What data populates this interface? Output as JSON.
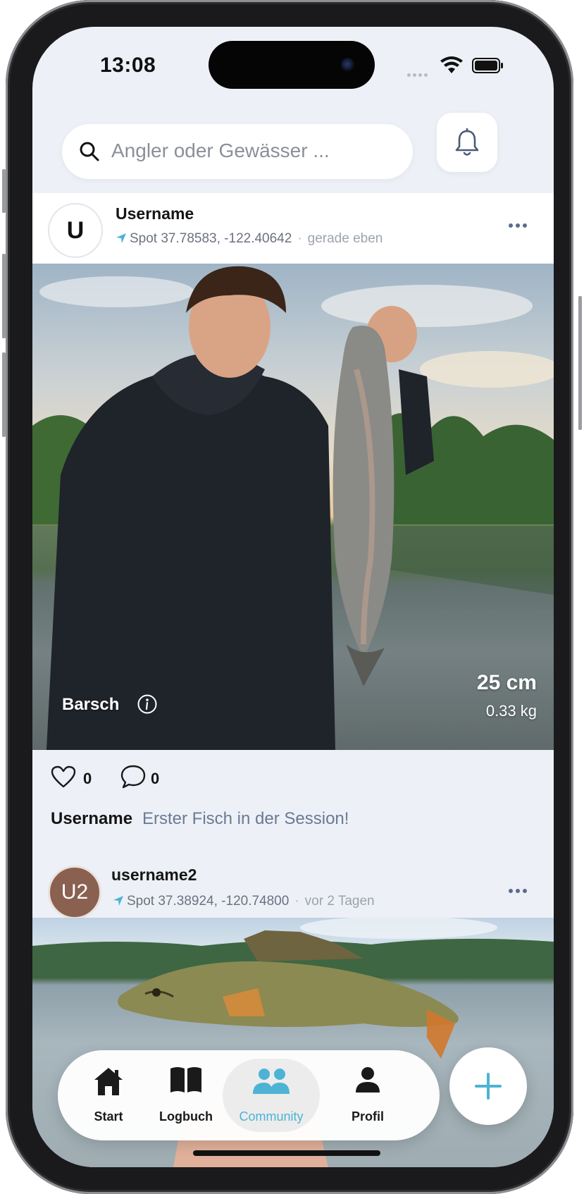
{
  "status_bar": {
    "time": "13:08"
  },
  "search": {
    "placeholder": "Angler oder Gewässer ..."
  },
  "posts": [
    {
      "avatar_initials": "U",
      "username": "Username",
      "spot": "Spot 37.78583, -122.40642",
      "time": "gerade eben",
      "species": "Barsch",
      "length": "25 cm",
      "weight": "0.33 kg",
      "likes": "0",
      "comments": "0",
      "caption_user": "Username",
      "caption": "Erster Fisch in der Session!"
    },
    {
      "avatar_initials": "U2",
      "username": "username2",
      "spot": "Spot 37.38924, -120.74800",
      "time": "vor 2 Tagen"
    }
  ],
  "tab_bar": {
    "items": [
      {
        "label": "Start",
        "icon": "home-icon"
      },
      {
        "label": "Logbuch",
        "icon": "book-icon"
      },
      {
        "label": "Community",
        "icon": "people-icon",
        "active": true
      },
      {
        "label": "Profil",
        "icon": "person-icon"
      }
    ]
  },
  "colors": {
    "accent": "#4db3d4",
    "background": "#edf0f6",
    "avatar2": "#8a6050"
  }
}
